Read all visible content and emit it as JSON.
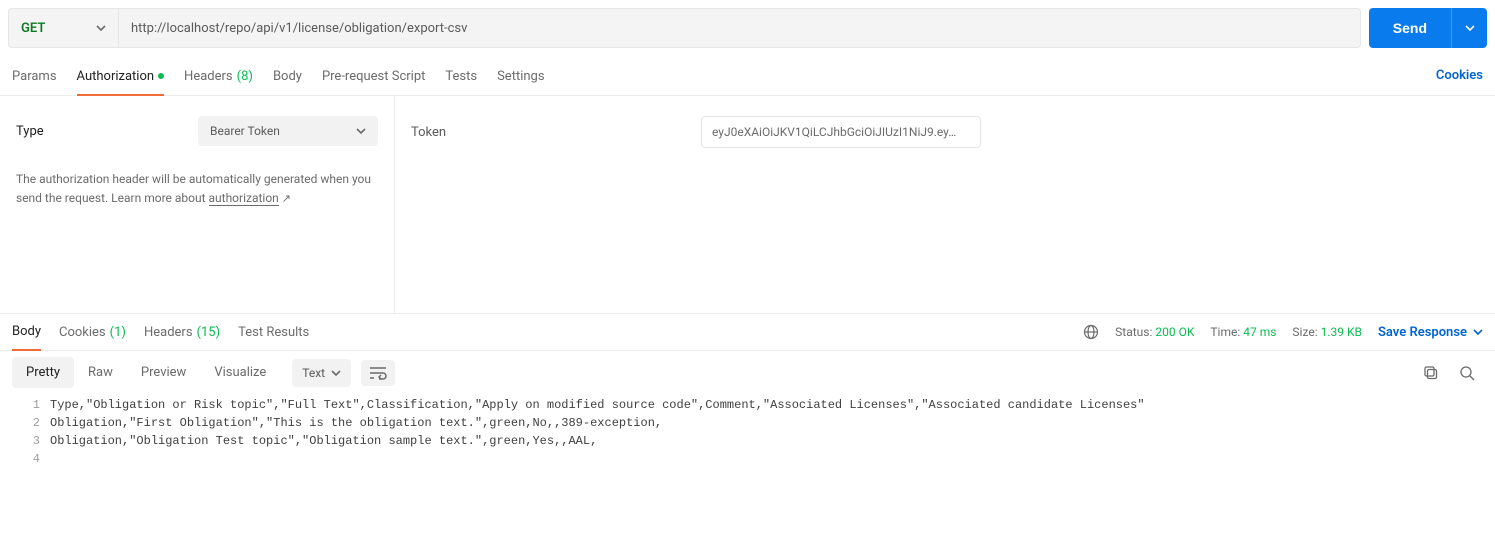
{
  "request": {
    "method": "GET",
    "url": "http://localhost/repo/api/v1/license/obligation/export-csv",
    "send_label": "Send"
  },
  "req_tabs": {
    "params": "Params",
    "authorization": "Authorization",
    "headers": "Headers",
    "headers_count": "(8)",
    "body": "Body",
    "prerequest": "Pre-request Script",
    "tests": "Tests",
    "settings": "Settings",
    "cookies_link": "Cookies"
  },
  "auth": {
    "type_label": "Type",
    "type_value": "Bearer Token",
    "description_pre": "The authorization header will be automatically generated when you send the request. Learn more about ",
    "description_link": "authorization",
    "token_label": "Token",
    "token_value": "eyJ0eXAiOiJKV1QiLCJhbGciOiJIUzI1NiJ9.ey…"
  },
  "res_tabs": {
    "body": "Body",
    "cookies": "Cookies",
    "cookies_count": "(1)",
    "headers": "Headers",
    "headers_count": "(15)",
    "test_results": "Test Results"
  },
  "res_meta": {
    "status_label": "Status:",
    "status_value": "200 OK",
    "time_label": "Time:",
    "time_value": "47 ms",
    "size_label": "Size:",
    "size_value": "1.39 KB",
    "save_response": "Save Response"
  },
  "view": {
    "pretty": "Pretty",
    "raw": "Raw",
    "preview": "Preview",
    "visualize": "Visualize",
    "body_type": "Text"
  },
  "code": {
    "line1": "Type,\"Obligation or Risk topic\",\"Full Text\",Classification,\"Apply on modified source code\",Comment,\"Associated Licenses\",\"Associated candidate Licenses\"",
    "line2": "Obligation,\"First Obligation\",\"This is the obligation text.\",green,No,,389-exception,",
    "line3": "Obligation,\"Obligation Test topic\",\"Obligation sample text.\",green,Yes,,AAL,",
    "line4": ""
  },
  "gutter": {
    "n1": "1",
    "n2": "2",
    "n3": "3",
    "n4": "4"
  }
}
